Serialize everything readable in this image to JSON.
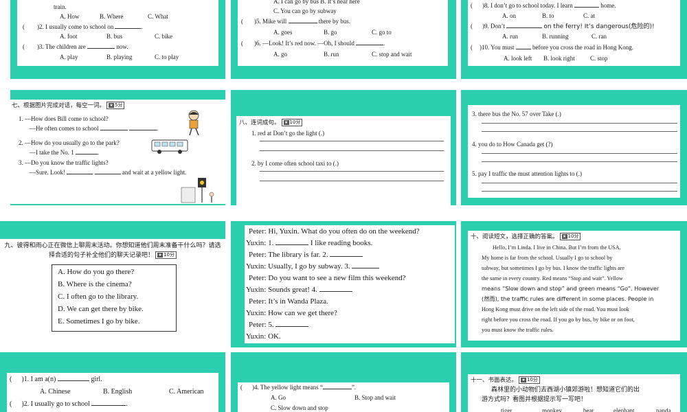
{
  "colors": {
    "tile": "#2bcfb0",
    "card": "#ffffff",
    "text": "#1a1a1a",
    "blank_line": "#333333"
  },
  "slide1": {
    "l1": "train.",
    "l1_options": [
      "A. How",
      "B. Where",
      "C. What"
    ],
    "q2_paren": "(",
    "q2": ")2. I usually come to school on",
    "q2_end": ".",
    "q2_options": [
      "A. foot",
      "B. bus",
      "C. bike"
    ],
    "q3_paren": "(",
    "q3": ")3. The children are",
    "q3_end": "now.",
    "q3_options": [
      "A. play",
      "B. playing",
      "C. to play"
    ]
  },
  "slide2": {
    "l0": "A. I can go by bus    B. It’s near here",
    "l1": "C. You can go by subway",
    "q5_paren": "(",
    "q5": ")5. Mike will",
    "q5_end": "there by bus.",
    "q5_options": [
      "A. goes",
      "B. go",
      "C. go to"
    ],
    "q6_paren": "(",
    "q6": ")6. —Look! It’s red now.    —Oh, I should",
    "q6_end": ".",
    "q6_options": [
      "A. go",
      "B. run",
      "C. stop and wait"
    ]
  },
  "slide3": {
    "q8_paren": "(",
    "q8": ")8. I don’t go to school today. I learn",
    "q8_end": "home.",
    "q8_options": [
      "A. on",
      "B. to",
      "C. at"
    ],
    "q9_paren": "(",
    "q9": ")9. Don’t",
    "q9_end": "on the ferry! It’s dangerous(危险的)!",
    "q9_options": [
      "A. run",
      "B. running",
      "C. ran"
    ],
    "q10_paren": "(",
    "q10": ")10. You must",
    "q10_end": "before you cross the road in Hong Kong.",
    "q10_options": [
      "A. look left",
      "B. look right",
      "C. stop"
    ]
  },
  "slide4": {
    "title": "七、根据图片完成对话，每空一词。",
    "badge": "5分",
    "lines": [
      "1. —How does Bill come to school?",
      "—He often comes to school",
      "2. —How do you usually go to the park?",
      "—I take the No. 1",
      "3. —Do you know the traffic lights?",
      "—Sure. Look!",
      "and wait at a yellow light."
    ],
    "dot": "."
  },
  "slide5": {
    "title": "八、连词成句。",
    "badge": "10分",
    "q1": "1. red   at   Don’t   go   the   light  (.)",
    "q2": "2. by   I   come   often   school   taxi   to  (.)"
  },
  "slide6": {
    "q3": "3. there   bus   the   No. 57   over   Take  (.)",
    "q4": "4. you   do   to   How   Canada   get  (?)",
    "q5": "5. pay   I   traffic   the   must   attention   lights   to  (.)"
  },
  "slide7": {
    "title": "九、彼得和雨心正在微信上聊周末活动。你想知道他们周末准备干什么吗？请选择合适的句子补全他们的聊天记录吧！",
    "badge": "10分",
    "options": [
      "A. How do you go there?",
      "B. Where is the cinema?",
      "C. I often go to the library.",
      "D. We can get there by bike.",
      "E. Sometimes I go by bike."
    ]
  },
  "slide8": {
    "lines": [
      {
        "speaker": "Peter:",
        "text": "Hi, Yuxin. What do you often do on the weekend?"
      },
      {
        "speaker": "Yuxin:",
        "text": "1.",
        "after": "I like reading books."
      },
      {
        "speaker": "Peter:",
        "text": "The library is far. 2.",
        "after": ""
      },
      {
        "speaker": "Yuxin:",
        "text": "Usually, I go by subway. 3.",
        "after": ""
      },
      {
        "speaker": "Peter:",
        "text": "Do you want to see a new film this weekend?"
      },
      {
        "speaker": "Yuxin:",
        "text": "Sounds great! 4.",
        "after": ""
      },
      {
        "speaker": "Peter:",
        "text": "It’s in Wanda Plaza."
      },
      {
        "speaker": "Yuxin:",
        "text": "How can we get there?"
      },
      {
        "speaker": "Peter:",
        "text": "5.",
        "after": ""
      },
      {
        "speaker": "Yuxin:",
        "text": "OK."
      }
    ]
  },
  "slide9": {
    "title": "十、阅读短文，选择正确的答案。",
    "badge": "10分",
    "lines": [
      "Hello, I’m Linda. I live in China. But I’m from the USA.",
      "My home is far from the school. Usually I go to school by",
      "subway, but sometimes I go by bus. I know the traffic lights are",
      "the same in every country. Red means “Stop and wait”. Yellow",
      "means “Slow down and stop” and green means “Go”. However",
      "(然而), the traffic rules are different in some places. People in",
      "Hong Kong must drive on the left side of the road. You must look",
      "right before you cross the road. If you go by bus, by bike or on foot,",
      "you must know the traffic rules."
    ]
  },
  "slide10": {
    "q1_paren": "(",
    "q1": ")1. I am a(n)",
    "q1_end": "girl.",
    "q1_options": [
      "A. Chinese",
      "B. English",
      "C. American"
    ],
    "q2_paren": "(",
    "q2": ")2. I usually go to school",
    "q2_end": "."
  },
  "slide11": {
    "q4_paren": "(",
    "q4": ")4. The yellow light means “",
    "q4_end": "”.",
    "q4_options": [
      "A. Go",
      "B. Stop and wait"
    ],
    "q4_c": "C. Slow down and stop"
  },
  "slide12": {
    "title": "十一、书面表达。",
    "badge": "10分",
    "text1": "森林里的小动物们去西湖小镇郊游啦！想知道它们的出",
    "text2": "游方式吗？看图并根据提示写一写吧！",
    "animals": [
      "tiger",
      "monkey",
      "bear",
      "elephant",
      "panda"
    ]
  }
}
